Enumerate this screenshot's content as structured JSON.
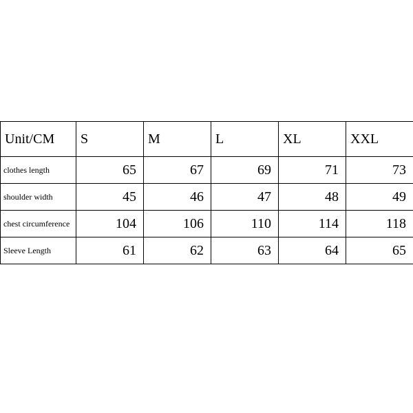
{
  "chart_data": {
    "type": "table",
    "title": "",
    "header_label": "Unit/CM",
    "sizes": [
      "S",
      "M",
      "L",
      "XL",
      "XXL"
    ],
    "rows": [
      {
        "label": "clothes length",
        "values": [
          65,
          67,
          69,
          71,
          73
        ]
      },
      {
        "label": "shoulder width",
        "values": [
          45,
          46,
          47,
          48,
          49
        ]
      },
      {
        "label": "chest circumference",
        "values": [
          104,
          106,
          110,
          114,
          118
        ]
      },
      {
        "label": "Sleeve Length",
        "values": [
          61,
          62,
          63,
          64,
          65
        ]
      }
    ]
  }
}
